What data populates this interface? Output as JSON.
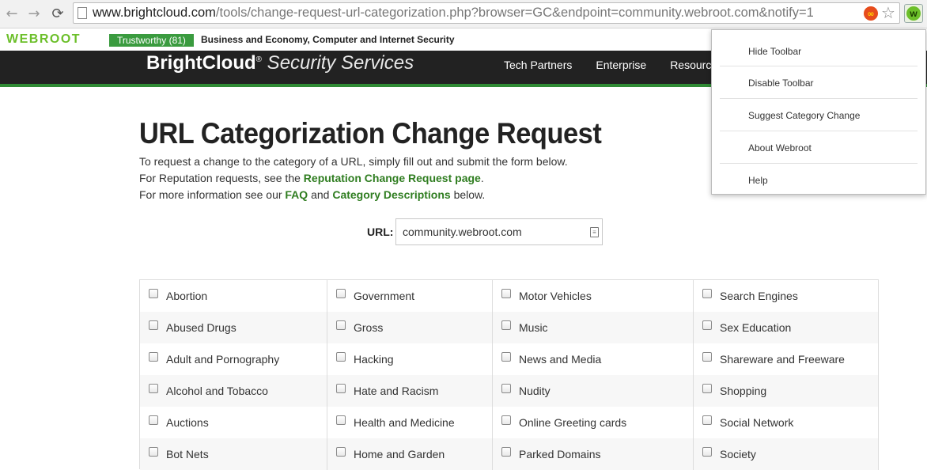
{
  "browser": {
    "url_host": "www.brightcloud.com",
    "url_path": "/tools/change-request-url-categorization.php?browser=GC&endpoint=community.webroot.com&notify=1"
  },
  "webroot_toolbar": {
    "logo": "WEBROOT",
    "badge": "Trustworthy (81)",
    "categories": "Business and Economy, Computer and Internet Security"
  },
  "site": {
    "brand_bold": "BrightCloud",
    "brand_reg": "®",
    "brand_rest": " Security Services",
    "nav": [
      "Tech Partners",
      "Enterprise",
      "Resources"
    ]
  },
  "main": {
    "title": "URL Categorization Change Request",
    "intro_line1": "To request a change to the category of a URL, simply fill out and submit the form below.",
    "intro_line2_pre": "For Reputation requests, see the ",
    "intro_line2_link": "Reputation Change Request page",
    "intro_line2_post": ".",
    "intro_line3_pre": "For more information see our ",
    "intro_line3_link1": "FAQ",
    "intro_line3_mid": " and ",
    "intro_line3_link2": "Category Descriptions",
    "intro_line3_post": " below.",
    "url_label": "URL:",
    "url_value": "community.webroot.com"
  },
  "categories": {
    "col1": [
      "Abortion",
      "Abused Drugs",
      "Adult and Pornography",
      "Alcohol and Tobacco",
      "Auctions",
      "Bot Nets"
    ],
    "col2": [
      "Government",
      "Gross",
      "Hacking",
      "Hate and Racism",
      "Health and Medicine",
      "Home and Garden"
    ],
    "col3": [
      "Motor Vehicles",
      "Music",
      "News and Media",
      "Nudity",
      "Online Greeting cards",
      "Parked Domains"
    ],
    "col4": [
      "Search Engines",
      "Sex Education",
      "Shareware and Freeware",
      "Shopping",
      "Social Network",
      "Society"
    ]
  },
  "dropdown": {
    "items": [
      "Hide Toolbar",
      "Disable Toolbar",
      "Suggest Category Change",
      "About Webroot",
      "Help"
    ]
  },
  "colors": {
    "accent_green": "#2f7d20",
    "webroot_green": "#6cbf2a",
    "header_bg": "#222222"
  }
}
